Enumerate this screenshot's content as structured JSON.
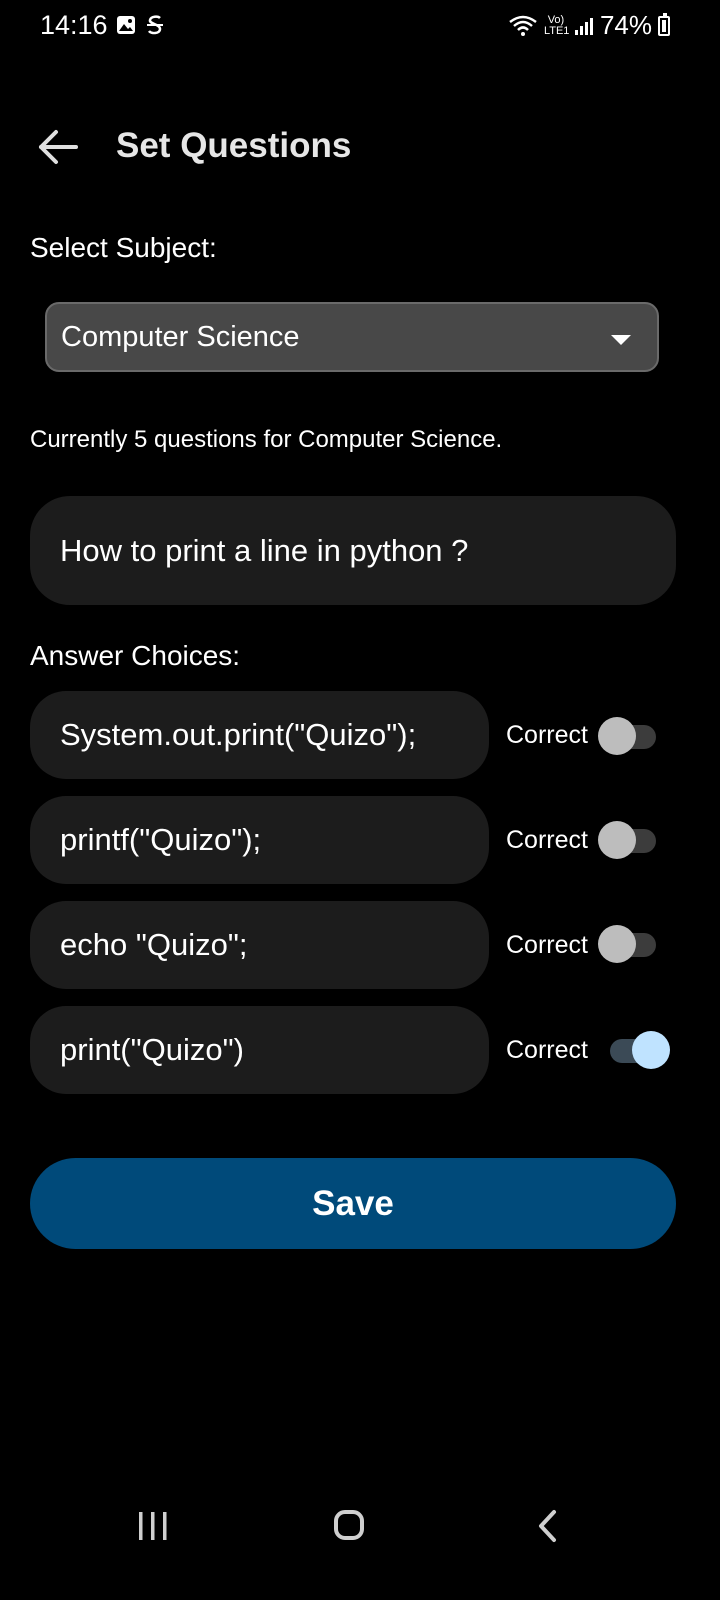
{
  "status_bar": {
    "time": "14:16",
    "left_icons": [
      "gallery-icon",
      "s-app-icon"
    ],
    "network_label": "Vo) LTE1",
    "battery_percent": "74%"
  },
  "app_bar": {
    "title": "Set Questions",
    "back_icon": "arrow-left-icon"
  },
  "subject": {
    "label": "Select Subject:",
    "selected": "Computer Science"
  },
  "question_count_text": "Currently 5 questions for Computer Science.",
  "question": {
    "text": "How to print a line in python ?"
  },
  "answers": {
    "label": "Answer Choices:",
    "choices": [
      {
        "text": "System.out.print(\"Quizo\");",
        "correct_label": "Correct",
        "correct": false
      },
      {
        "text": "printf(\"Quizo\");",
        "correct_label": "Correct",
        "correct": false
      },
      {
        "text": "echo \"Quizo\";",
        "correct_label": "Correct",
        "correct": false
      },
      {
        "text": "print(\"Quizo\")",
        "correct_label": "Correct",
        "correct": true
      }
    ]
  },
  "save_label": "Save",
  "colors": {
    "background": "#000000",
    "field_bg": "#1c1c1c",
    "select_bg": "#484848",
    "save_button": "#004a7a",
    "switch_on_thumb": "#bfe3ff"
  }
}
